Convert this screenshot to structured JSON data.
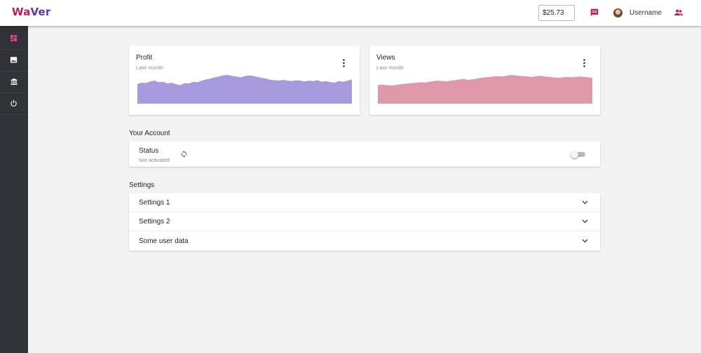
{
  "header": {
    "logo_part1": "Wa",
    "logo_part2": "Ver",
    "balance": "$25.73",
    "username": "Username",
    "icons": [
      "chat-icon",
      "avatar",
      "users-icon"
    ],
    "accent_color": "#c2185b"
  },
  "sidebar": {
    "items": [
      {
        "icon": "dashboard-icon",
        "active": true
      },
      {
        "icon": "image-icon",
        "active": false
      },
      {
        "icon": "bank-icon",
        "active": false
      },
      {
        "icon": "power-icon",
        "active": false
      }
    ]
  },
  "cards": {
    "profit": {
      "title": "Profit",
      "subtitle": "Last month",
      "color": "#a898dc"
    },
    "views": {
      "title": "Views",
      "subtitle": "Last month",
      "color": "#df98a9"
    }
  },
  "chart_data": [
    {
      "type": "area",
      "values": [
        0.55,
        0.62,
        0.6,
        0.68,
        0.72,
        0.64,
        0.66,
        0.58,
        0.62,
        0.54,
        0.5,
        0.6,
        0.58,
        0.66,
        0.64,
        0.72,
        0.78,
        0.82,
        0.88,
        0.92,
        0.98,
        1.0,
        0.96,
        0.92,
        0.88,
        0.94,
        0.98,
        0.95,
        0.9,
        0.86,
        0.82,
        0.76,
        0.74,
        0.72,
        0.76,
        0.72,
        0.7,
        0.74,
        0.72,
        0.68,
        0.72,
        0.7,
        0.74,
        0.66,
        0.7,
        0.64,
        0.62,
        0.7,
        0.66,
        0.72,
        0.78
      ]
    },
    {
      "type": "area",
      "values": [
        0.5,
        0.52,
        0.5,
        0.48,
        0.5,
        0.53,
        0.56,
        0.58,
        0.6,
        0.62,
        0.64,
        0.62,
        0.66,
        0.7,
        0.72,
        0.7,
        0.68,
        0.72,
        0.74,
        0.78,
        0.8,
        0.76,
        0.78,
        0.82,
        0.86,
        0.88,
        0.9,
        0.92,
        0.94,
        0.92,
        0.96,
        1.0,
        0.98,
        0.96,
        0.94,
        0.92,
        0.9,
        0.94,
        0.96,
        0.92,
        0.9,
        0.88,
        0.86,
        0.88,
        0.9,
        0.88,
        0.9,
        0.92,
        0.9,
        0.88,
        0.86
      ]
    }
  ],
  "account": {
    "section_label": "Your Account",
    "status_title": "Status",
    "status_value": "Not activated",
    "toggle_on": false
  },
  "settings": {
    "section_label": "Settings",
    "items": [
      "Settings 1",
      "Settings 2",
      "Some user data"
    ]
  }
}
